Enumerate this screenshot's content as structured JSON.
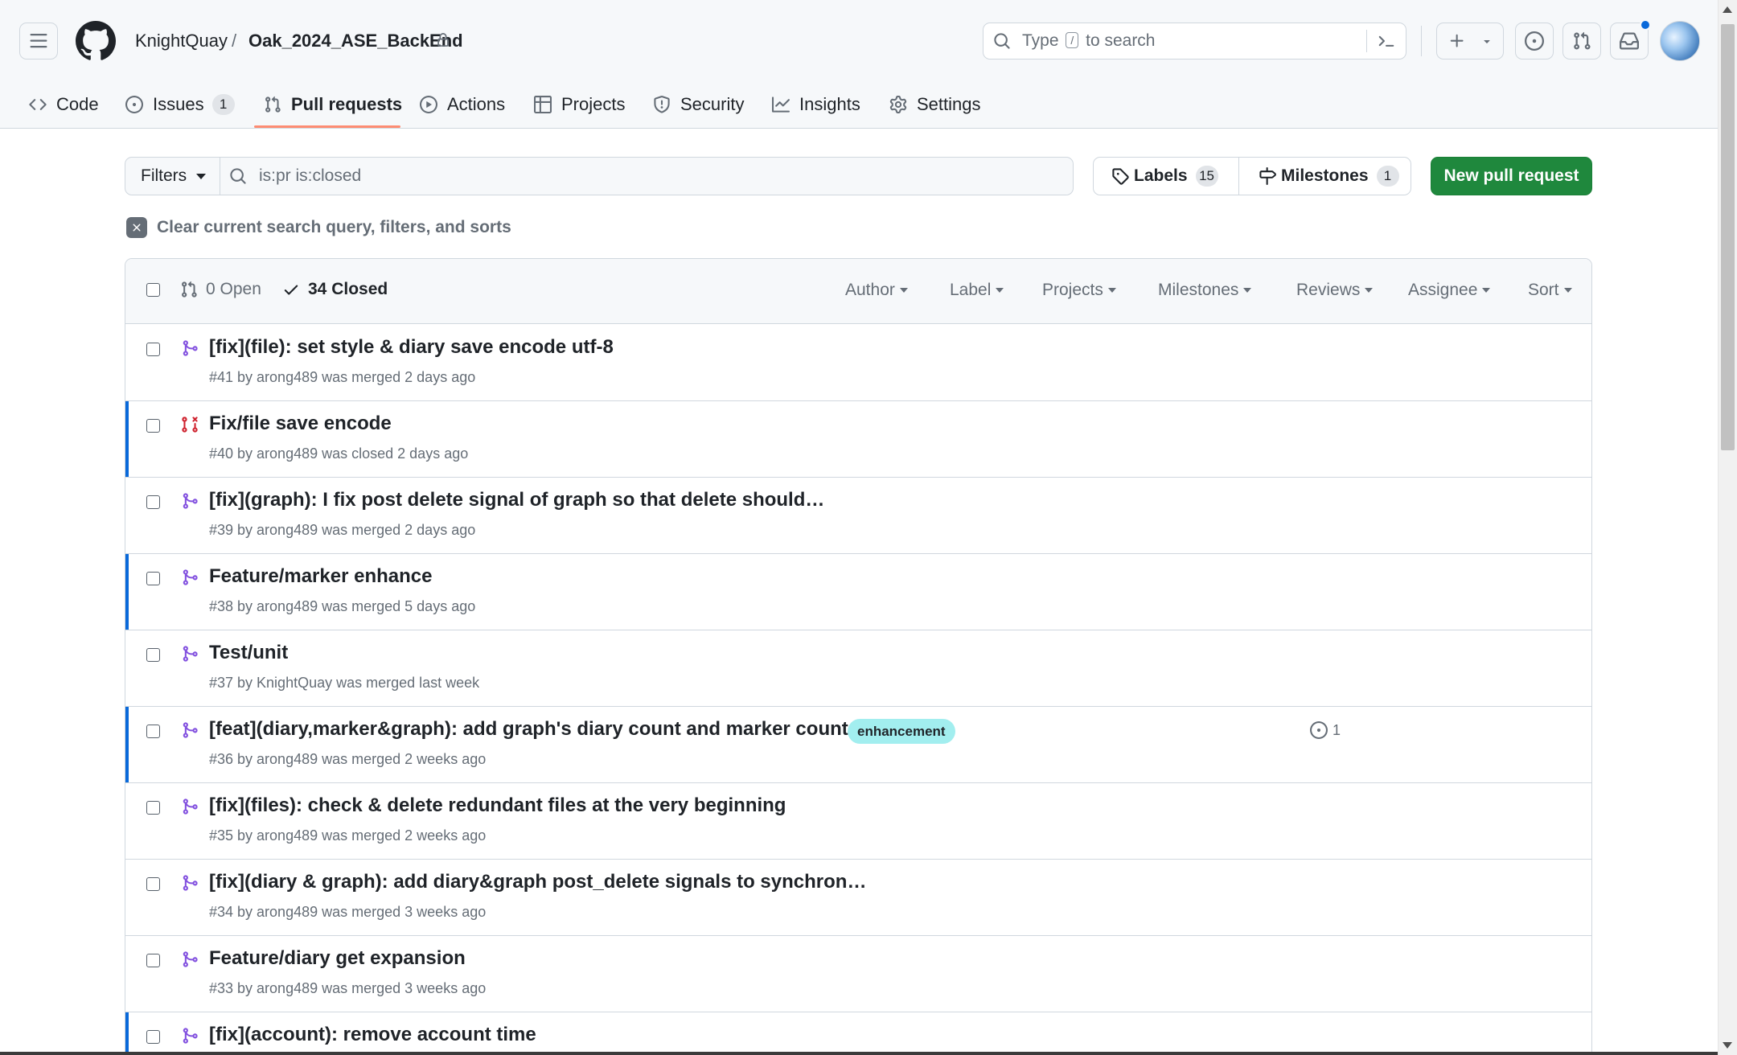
{
  "header": {
    "owner": "KnightQuay",
    "separator": "/",
    "repo": "Oak_2024_ASE_BackEnd",
    "search": {
      "prefix": "Type",
      "key": "/",
      "suffix": "to search"
    }
  },
  "tabs": [
    {
      "label": "Code",
      "icon": "code-icon"
    },
    {
      "label": "Issues",
      "icon": "issue-opened-icon",
      "count": "1"
    },
    {
      "label": "Pull requests",
      "icon": "git-pull-request-icon",
      "selected": true
    },
    {
      "label": "Actions",
      "icon": "play-icon"
    },
    {
      "label": "Projects",
      "icon": "table-icon"
    },
    {
      "label": "Security",
      "icon": "shield-icon"
    },
    {
      "label": "Insights",
      "icon": "graph-icon"
    },
    {
      "label": "Settings",
      "icon": "gear-icon"
    }
  ],
  "toolbar": {
    "filters_label": "Filters",
    "query": "is:pr is:closed",
    "labels_label": "Labels",
    "labels_count": "15",
    "milestones_label": "Milestones",
    "milestones_count": "1",
    "new_pr_label": "New pull request"
  },
  "clear_label": "Clear current search query, filters, and sorts",
  "list_header": {
    "open_label": "0 Open",
    "closed_label": "34 Closed",
    "filters": [
      "Author",
      "Label",
      "Projects",
      "Milestones",
      "Reviews",
      "Assignee",
      "Sort"
    ]
  },
  "pulls": [
    {
      "title": "[fix](file): set style & diary save encode utf-8",
      "meta": "#41 by arong489 was merged 2 days ago",
      "state": "merged"
    },
    {
      "title": "Fix/file save encode",
      "meta": "#40 by arong489 was closed 2 days ago",
      "state": "closed"
    },
    {
      "title": "[fix](graph): I fix post delete signal of graph so that delete should…",
      "meta": "#39 by arong489 was merged 2 days ago",
      "state": "merged"
    },
    {
      "title": "Feature/marker enhance",
      "meta": "#38 by arong489 was merged 5 days ago",
      "state": "merged"
    },
    {
      "title": "Test/unit",
      "meta": "#37 by KnightQuay was merged last week",
      "state": "merged"
    },
    {
      "title": "[feat](diary,marker&graph): add graph's diary count and marker count;…",
      "meta": "#36 by arong489 was merged 2 weeks ago",
      "state": "merged",
      "label": {
        "text": "enhancement",
        "bg": "#a2eeef",
        "fg": "#1f2328"
      },
      "comments": "1"
    },
    {
      "title": "[fix](files): check & delete redundant files at the very beginning",
      "meta": "#35 by arong489 was merged 2 weeks ago",
      "state": "merged"
    },
    {
      "title": "[fix](diary & graph): add diary&graph post_delete signals to synchron…",
      "meta": "#34 by arong489 was merged 3 weeks ago",
      "state": "merged"
    },
    {
      "title": "Feature/diary get expansion",
      "meta": "#33 by arong489 was merged 3 weeks ago",
      "state": "merged"
    },
    {
      "title": "[fix](account): remove account time",
      "meta": "",
      "state": "merged"
    }
  ],
  "colors": {
    "merged": "#8250df",
    "closed": "#cf222e",
    "primary_button": "#1f883d",
    "tab_underline": "#fd8c73",
    "row_highlight": "#0969da"
  }
}
